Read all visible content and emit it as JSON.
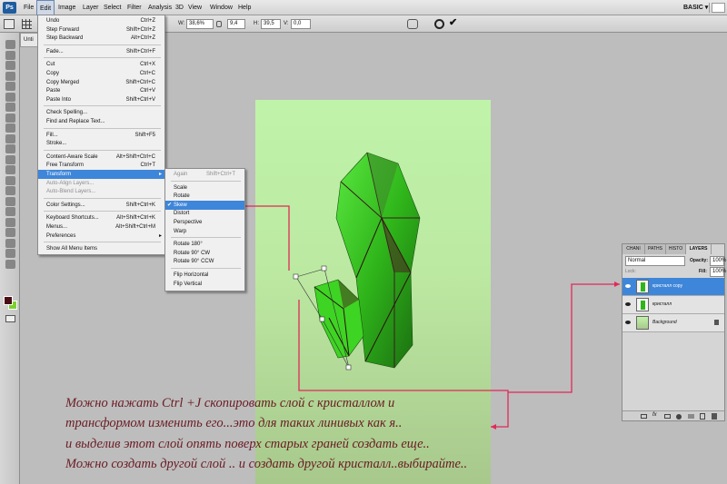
{
  "app": {
    "logo": "Ps",
    "workspace": "BASIC",
    "workspace_arrow": "▾"
  },
  "menubar": {
    "items": [
      "File",
      "Edit",
      "Image",
      "Layer",
      "Select",
      "Filter",
      "Analysis",
      "3D",
      "View",
      "Window",
      "Help"
    ]
  },
  "options": {
    "w_label": "W:",
    "w_value": "38,6%",
    "h_label": "H:",
    "h_value": "39,5",
    "angle_value": "9,4",
    "skew_h_label": "H:",
    "skew_v_label": "V:",
    "v_value": "0,0",
    "zoom": "66,7%"
  },
  "document": {
    "tab_label": "Unti"
  },
  "edit_menu": [
    {
      "label": "Undo",
      "shortcut": "Ctrl+Z",
      "disabled": false
    },
    {
      "label": "Step Forward",
      "shortcut": "Shift+Ctrl+Z",
      "disabled": false
    },
    {
      "label": "Step Backward",
      "shortcut": "Alt+Ctrl+Z",
      "disabled": false
    },
    {
      "sep": true
    },
    {
      "label": "Fade...",
      "shortcut": "Shift+Ctrl+F",
      "disabled": false
    },
    {
      "sep": true
    },
    {
      "label": "Cut",
      "shortcut": "Ctrl+X",
      "disabled": false
    },
    {
      "label": "Copy",
      "shortcut": "Ctrl+C",
      "disabled": false
    },
    {
      "label": "Copy Merged",
      "shortcut": "Shift+Ctrl+C",
      "disabled": false
    },
    {
      "label": "Paste",
      "shortcut": "Ctrl+V",
      "disabled": false
    },
    {
      "label": "Paste Into",
      "shortcut": "Shift+Ctrl+V",
      "disabled": false
    },
    {
      "sep": true
    },
    {
      "label": "Check Spelling...",
      "shortcut": "",
      "disabled": false
    },
    {
      "label": "Find and Replace Text...",
      "shortcut": "",
      "disabled": false
    },
    {
      "sep": true
    },
    {
      "label": "Fill...",
      "shortcut": "Shift+F5",
      "disabled": false
    },
    {
      "label": "Stroke...",
      "shortcut": "",
      "disabled": false
    },
    {
      "sep": true
    },
    {
      "label": "Content-Aware Scale",
      "shortcut": "Alt+Shift+Ctrl+C",
      "disabled": false
    },
    {
      "label": "Free Transform",
      "shortcut": "Ctrl+T",
      "disabled": false
    },
    {
      "label": "Transform",
      "shortcut": "",
      "disabled": false,
      "selected": true,
      "submenu": true
    },
    {
      "label": "Auto-Align Layers...",
      "shortcut": "",
      "disabled": true
    },
    {
      "label": "Auto-Blend Layers...",
      "shortcut": "",
      "disabled": true
    },
    {
      "sep": true
    },
    {
      "label": "Color Settings...",
      "shortcut": "Shift+Ctrl+K",
      "disabled": false
    },
    {
      "sep": true
    },
    {
      "label": "Keyboard Shortcuts...",
      "shortcut": "Alt+Shift+Ctrl+K",
      "disabled": false
    },
    {
      "label": "Menus...",
      "shortcut": "Alt+Shift+Ctrl+M",
      "disabled": false
    },
    {
      "label": "Preferences",
      "shortcut": "",
      "disabled": false,
      "submenu": true
    },
    {
      "sep": true
    },
    {
      "label": "Show All Menu Items",
      "shortcut": "",
      "disabled": false
    }
  ],
  "transform_menu": [
    {
      "label": "Again",
      "shortcut": "Shift+Ctrl+T",
      "disabled": true
    },
    {
      "sep": true
    },
    {
      "label": "Scale",
      "shortcut": ""
    },
    {
      "label": "Rotate",
      "shortcut": ""
    },
    {
      "label": "Skew",
      "shortcut": "",
      "selected": true,
      "checked": true
    },
    {
      "label": "Distort",
      "shortcut": ""
    },
    {
      "label": "Perspective",
      "shortcut": ""
    },
    {
      "label": "Warp",
      "shortcut": ""
    },
    {
      "sep": true
    },
    {
      "label": "Rotate 180°",
      "shortcut": ""
    },
    {
      "label": "Rotate 90° CW",
      "shortcut": ""
    },
    {
      "label": "Rotate 90° CCW",
      "shortcut": ""
    },
    {
      "sep": true
    },
    {
      "label": "Flip Horizontal",
      "shortcut": ""
    },
    {
      "label": "Flip Vertical",
      "shortcut": ""
    }
  ],
  "layers_panel": {
    "tabs": [
      "CHANI",
      "PATHS",
      "HISTO",
      "LAYERS"
    ],
    "blend_mode": "Normal",
    "opacity_label": "Opacity:",
    "opacity_value": "100%",
    "lock_label": "Lock:",
    "fill_label": "Fill:",
    "fill_value": "100%",
    "layers": [
      {
        "name": "кристалл copy",
        "selected": true
      },
      {
        "name": "кристалл",
        "selected": false
      },
      {
        "name": "Background",
        "selected": false
      }
    ]
  },
  "annotation": {
    "lines": [
      "Можно  нажать Ctrl +J скопировать слой с кристаллом  и",
      "трансформом изменить его...это для таких линивых как я..",
      "и выделив этот слой опять поверх старых граней создать еще..",
      "Можно создать другой слой .. и создать другой кристалл..выбирайте.."
    ]
  },
  "colors": {
    "selection": "#3e86d9",
    "crystal": "#37c81f",
    "annotation": "#6a1c24",
    "arrow": "#e02a58"
  }
}
